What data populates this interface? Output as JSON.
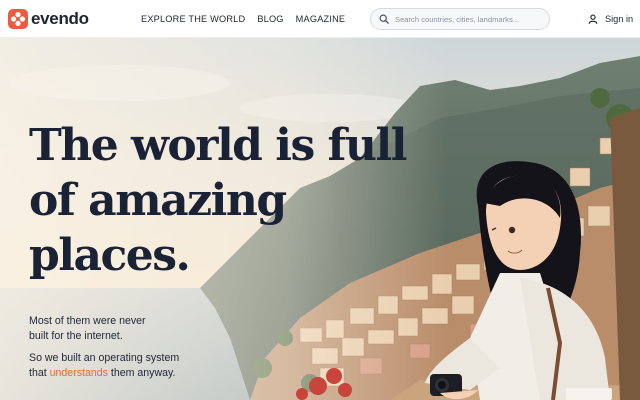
{
  "brand": {
    "name": "evendo",
    "accent": "#e85c3f"
  },
  "nav": {
    "items": [
      "EXPLORE THE WORLD",
      "BLOG",
      "MAGAZINE"
    ]
  },
  "search": {
    "placeholder": "Search countries, cities, landmarks...",
    "value": ""
  },
  "account": {
    "signin_label": "Sign in"
  },
  "hero": {
    "title_lines": [
      "The world is full",
      "of amazing",
      "places."
    ],
    "body_line_1": "Most of them were never",
    "body_line_2": "built for the internet.",
    "body_line_3": "So we built an operating system",
    "body_line_4_before": "that ",
    "body_line_4_highlight": "understands",
    "body_line_4_after": " them anyway.",
    "highlight_color": "#e36a3c"
  },
  "icons": [
    "logo-mark-icon",
    "search-icon",
    "user-icon"
  ]
}
